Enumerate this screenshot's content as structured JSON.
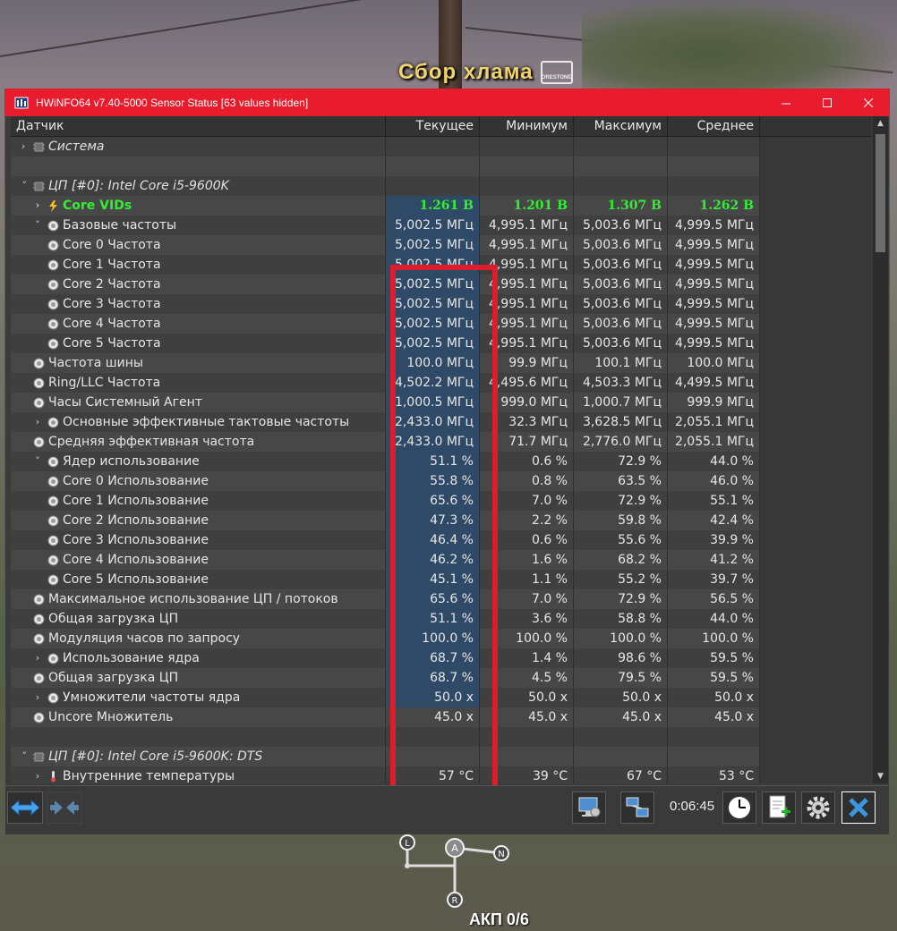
{
  "background": {
    "game_title": "Сбор хлама",
    "game_logo_text": "ORESTONE",
    "hud_text": "АКП 0/6",
    "hud_gear_letters": [
      "L",
      "A",
      "N",
      "R"
    ]
  },
  "window": {
    "title": "HWiNFO64 v7.40-5000 Sensor Status [63 values hidden]",
    "accent_color": "#e81c2c"
  },
  "columns": [
    "Датчик",
    "Текущее",
    "Минимум",
    "Максимум",
    "Среднее"
  ],
  "rows": [
    {
      "name": "Система",
      "type": "group",
      "expander": "›",
      "icon": "chip-icon",
      "cur": "",
      "min": "",
      "max": "",
      "avg": ""
    },
    {
      "name": "",
      "type": "blank",
      "expander": "",
      "icon": "",
      "cur": "",
      "min": "",
      "max": "",
      "avg": ""
    },
    {
      "name": "ЦП [#0]: Intel Core i5-9600K",
      "type": "group",
      "expander": "˅",
      "icon": "chip-icon",
      "cur": "",
      "min": "",
      "max": "",
      "avg": ""
    },
    {
      "name": "Core VIDs",
      "type": "vid",
      "expander": "›",
      "icon": "bolt-icon",
      "cur": "1.261 В",
      "min": "1.201 В",
      "max": "1.307 В",
      "avg": "1.262 В"
    },
    {
      "name": "Базовые частоты",
      "type": "parent",
      "expander": "˅",
      "icon": "clock-icon",
      "cur": "5,002.5 МГц",
      "min": "4,995.1 МГц",
      "max": "5,003.6 МГц",
      "avg": "4,999.5 МГц"
    },
    {
      "name": "Core 0 Частота",
      "type": "child",
      "expander": "",
      "icon": "clock-icon",
      "cur": "5,002.5 МГц",
      "min": "4,995.1 МГц",
      "max": "5,003.6 МГц",
      "avg": "4,999.5 МГц"
    },
    {
      "name": "Core 1 Частота",
      "type": "child",
      "expander": "",
      "icon": "clock-icon",
      "cur": "5,002.5 МГц",
      "min": "4,995.1 МГц",
      "max": "5,003.6 МГц",
      "avg": "4,999.5 МГц"
    },
    {
      "name": "Core 2 Частота",
      "type": "child",
      "expander": "",
      "icon": "clock-icon",
      "cur": "5,002.5 МГц",
      "min": "4,995.1 МГц",
      "max": "5,003.6 МГц",
      "avg": "4,999.5 МГц"
    },
    {
      "name": "Core 3 Частота",
      "type": "child",
      "expander": "",
      "icon": "clock-icon",
      "cur": "5,002.5 МГц",
      "min": "4,995.1 МГц",
      "max": "5,003.6 МГц",
      "avg": "4,999.5 МГц"
    },
    {
      "name": "Core 4 Частота",
      "type": "child",
      "expander": "",
      "icon": "clock-icon",
      "cur": "5,002.5 МГц",
      "min": "4,995.1 МГц",
      "max": "5,003.6 МГц",
      "avg": "4,999.5 МГц"
    },
    {
      "name": "Core 5 Частота",
      "type": "child",
      "expander": "",
      "icon": "clock-icon",
      "cur": "5,002.5 МГц",
      "min": "4,995.1 МГц",
      "max": "5,003.6 МГц",
      "avg": "4,999.5 МГц"
    },
    {
      "name": "Частота шины",
      "type": "item",
      "expander": "",
      "icon": "clock-icon",
      "cur": "100.0 МГц",
      "min": "99.9 МГц",
      "max": "100.1 МГц",
      "avg": "100.0 МГц"
    },
    {
      "name": "Ring/LLC Частота",
      "type": "item",
      "expander": "",
      "icon": "clock-icon",
      "cur": "4,502.2 МГц",
      "min": "4,495.6 МГц",
      "max": "4,503.3 МГц",
      "avg": "4,499.5 МГц"
    },
    {
      "name": "Часы Системный Агент",
      "type": "item",
      "expander": "",
      "icon": "clock-icon",
      "cur": "1,000.5 МГц",
      "min": "999.0 МГц",
      "max": "1,000.7 МГц",
      "avg": "999.9 МГц"
    },
    {
      "name": "Основные эффективные тактовые частоты",
      "type": "parent",
      "expander": "›",
      "icon": "clock-icon",
      "cur": "2,433.0 МГц",
      "min": "32.3 МГц",
      "max": "3,628.5 МГц",
      "avg": "2,055.1 МГц"
    },
    {
      "name": "Средняя эффективная частота",
      "type": "item",
      "expander": "",
      "icon": "clock-icon",
      "cur": "2,433.0 МГц",
      "min": "71.7 МГц",
      "max": "2,776.0 МГц",
      "avg": "2,055.1 МГц"
    },
    {
      "name": "Ядер использование",
      "type": "parent",
      "expander": "˅",
      "icon": "clock-icon",
      "cur": "51.1 %",
      "min": "0.6 %",
      "max": "72.9 %",
      "avg": "44.0 %"
    },
    {
      "name": "Core 0 Использование",
      "type": "child",
      "expander": "",
      "icon": "clock-icon",
      "cur": "55.8 %",
      "min": "0.8 %",
      "max": "63.5 %",
      "avg": "46.0 %"
    },
    {
      "name": "Core 1 Использование",
      "type": "child",
      "expander": "",
      "icon": "clock-icon",
      "cur": "65.6 %",
      "min": "7.0 %",
      "max": "72.9 %",
      "avg": "55.1 %"
    },
    {
      "name": "Core 2 Использование",
      "type": "child",
      "expander": "",
      "icon": "clock-icon",
      "cur": "47.3 %",
      "min": "2.2 %",
      "max": "59.8 %",
      "avg": "42.4 %"
    },
    {
      "name": "Core 3 Использование",
      "type": "child",
      "expander": "",
      "icon": "clock-icon",
      "cur": "46.4 %",
      "min": "0.6 %",
      "max": "55.6 %",
      "avg": "39.9 %"
    },
    {
      "name": "Core 4 Использование",
      "type": "child",
      "expander": "",
      "icon": "clock-icon",
      "cur": "46.2 %",
      "min": "1.6 %",
      "max": "68.2 %",
      "avg": "41.2 %"
    },
    {
      "name": "Core 5 Использование",
      "type": "child",
      "expander": "",
      "icon": "clock-icon",
      "cur": "45.1 %",
      "min": "1.1 %",
      "max": "55.2 %",
      "avg": "39.7 %"
    },
    {
      "name": "Максимальное использование ЦП / потоков",
      "type": "item",
      "expander": "",
      "icon": "clock-icon",
      "cur": "65.6 %",
      "min": "7.0 %",
      "max": "72.9 %",
      "avg": "56.5 %"
    },
    {
      "name": "Общая загрузка ЦП",
      "type": "item",
      "expander": "",
      "icon": "clock-icon",
      "cur": "51.1 %",
      "min": "3.6 %",
      "max": "58.8 %",
      "avg": "44.0 %"
    },
    {
      "name": "Модуляция часов по запросу",
      "type": "item",
      "expander": "",
      "icon": "clock-icon",
      "cur": "100.0 %",
      "min": "100.0 %",
      "max": "100.0 %",
      "avg": "100.0 %"
    },
    {
      "name": "Использование ядра",
      "type": "parent",
      "expander": "›",
      "icon": "clock-icon",
      "cur": "68.7 %",
      "min": "1.4 %",
      "max": "98.6 %",
      "avg": "59.5 %"
    },
    {
      "name": "Общая загрузка ЦП",
      "type": "item",
      "expander": "",
      "icon": "clock-icon",
      "cur": "68.7 %",
      "min": "4.5 %",
      "max": "79.5 %",
      "avg": "59.5 %"
    },
    {
      "name": "Умножители частоты ядра",
      "type": "parent",
      "expander": "›",
      "icon": "clock-icon",
      "cur": "50.0 x",
      "min": "50.0 x",
      "max": "50.0 x",
      "avg": "50.0 x"
    },
    {
      "name": "Uncore Множитель",
      "type": "item",
      "expander": "",
      "icon": "clock-icon",
      "cur": "45.0 x",
      "min": "45.0 x",
      "max": "45.0 x",
      "avg": "45.0 x"
    },
    {
      "name": "",
      "type": "blank",
      "expander": "",
      "icon": "",
      "cur": "",
      "min": "",
      "max": "",
      "avg": ""
    },
    {
      "name": "ЦП [#0]: Intel Core i5-9600K: DTS",
      "type": "group",
      "expander": "˅",
      "icon": "chip-icon",
      "cur": "",
      "min": "",
      "max": "",
      "avg": ""
    },
    {
      "name": "Внутренние температуры",
      "type": "parent",
      "expander": "›",
      "icon": "thermometer-icon",
      "cur": "57 °C",
      "min": "39 °C",
      "max": "67 °C",
      "avg": "53 °C"
    }
  ],
  "toolbar": {
    "timer": "0:06:45"
  },
  "highlight_color": "#e01b2a",
  "value_color_vid": "#33ee33"
}
